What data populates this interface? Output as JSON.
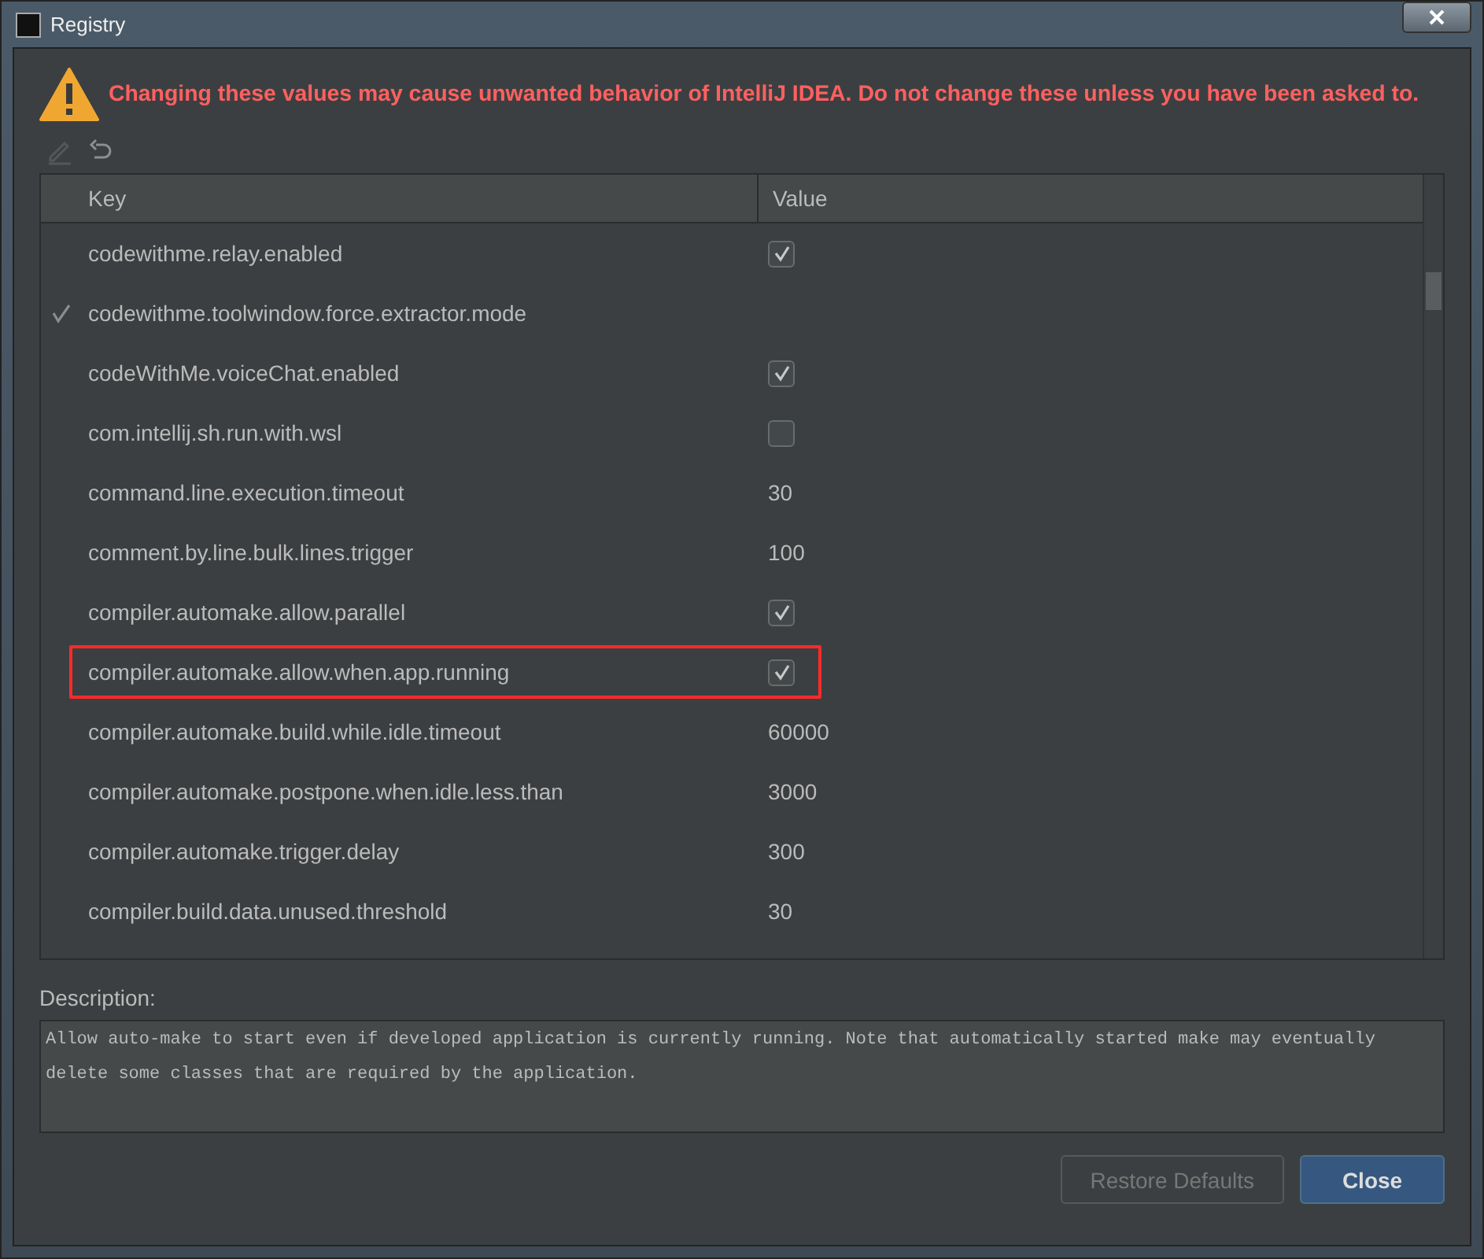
{
  "window": {
    "title": "Registry"
  },
  "warning": "Changing these values may cause unwanted behavior of IntelliJ IDEA. Do not change these unless you have been asked to.",
  "toolbar": [
    {
      "kind": "edit",
      "disabled": true
    },
    {
      "kind": "revert",
      "disabled": false
    }
  ],
  "table": {
    "columns": [
      "Key",
      "Value"
    ],
    "rows": [
      {
        "key": "codewithme.relay.enabled",
        "kind": "checkbox",
        "checked": true,
        "modified": false,
        "highlighted": false
      },
      {
        "key": "codewithme.toolwindow.force.extractor.mode",
        "kind": "empty",
        "modified": true,
        "highlighted": false
      },
      {
        "key": "codeWithMe.voiceChat.enabled",
        "kind": "checkbox",
        "checked": true,
        "modified": false,
        "highlighted": false
      },
      {
        "key": "com.intellij.sh.run.with.wsl",
        "kind": "checkbox",
        "checked": false,
        "modified": false,
        "highlighted": false
      },
      {
        "key": "command.line.execution.timeout",
        "kind": "text",
        "value": "30",
        "modified": false,
        "highlighted": false
      },
      {
        "key": "comment.by.line.bulk.lines.trigger",
        "kind": "text",
        "value": "100",
        "modified": false,
        "highlighted": false
      },
      {
        "key": "compiler.automake.allow.parallel",
        "kind": "checkbox",
        "checked": true,
        "modified": false,
        "highlighted": false
      },
      {
        "key": "compiler.automake.allow.when.app.running",
        "kind": "checkbox",
        "checked": true,
        "modified": false,
        "highlighted": true
      },
      {
        "key": "compiler.automake.build.while.idle.timeout",
        "kind": "text",
        "value": "60000",
        "modified": false,
        "highlighted": false
      },
      {
        "key": "compiler.automake.postpone.when.idle.less.than",
        "kind": "text",
        "value": "3000",
        "modified": false,
        "highlighted": false
      },
      {
        "key": "compiler.automake.trigger.delay",
        "kind": "text",
        "value": "300",
        "modified": false,
        "highlighted": false
      },
      {
        "key": "compiler.build.data.unused.threshold",
        "kind": "text",
        "value": "30",
        "modified": false,
        "highlighted": false
      }
    ]
  },
  "description": {
    "label": "Description:",
    "text": "Allow auto-make to start even if developed application is currently running. Note that automatically started make may eventually delete some classes that are required by the application."
  },
  "buttons": [
    {
      "label": "Restore Defaults",
      "disabled": true,
      "default": false
    },
    {
      "label": "Close",
      "disabled": false,
      "default": true
    }
  ]
}
